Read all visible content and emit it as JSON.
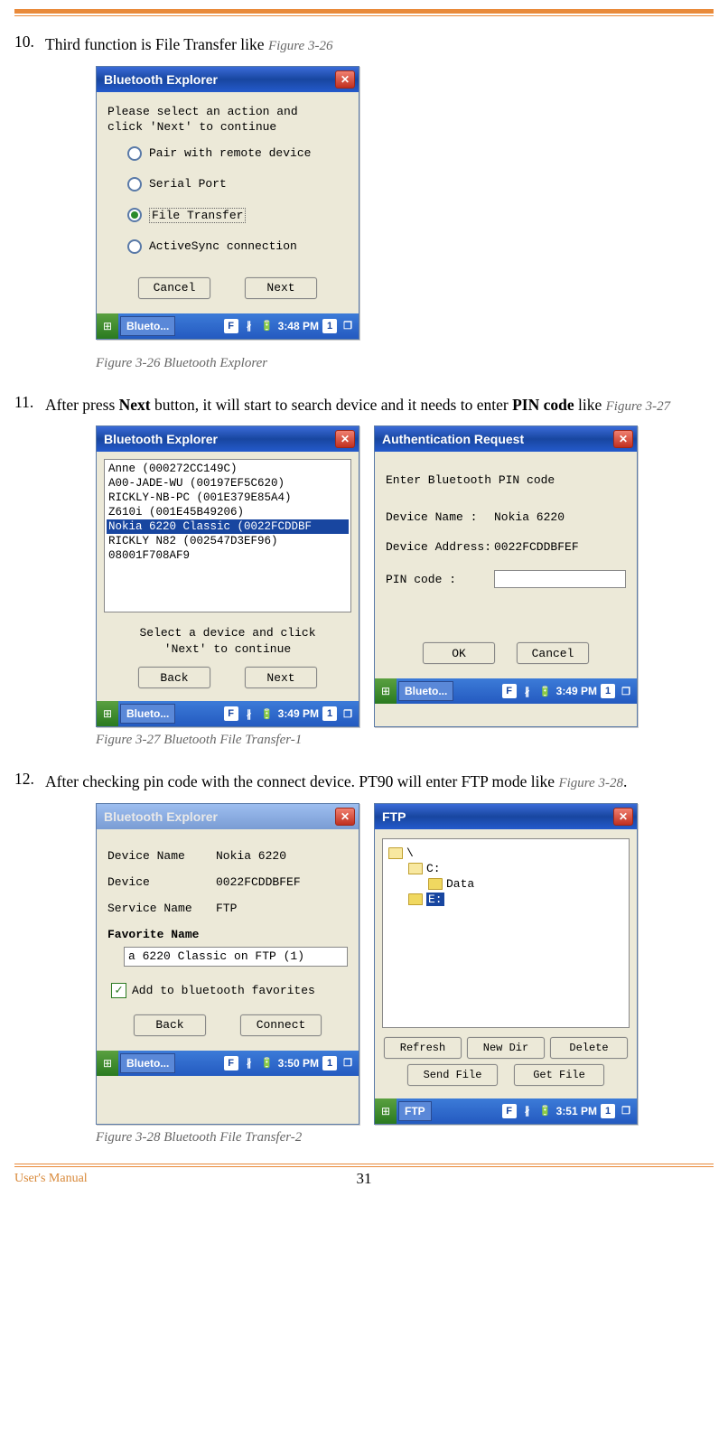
{
  "list": {
    "item10_num": "10.",
    "item10_text_a": "Third function is File Transfer like ",
    "item10_ref": "Figure 3-26",
    "item11_num": "11.",
    "item11_text_a": "After press ",
    "item11_bold1": "Next",
    "item11_text_b": " button, it will start to search device and it needs to enter ",
    "item11_bold2": "PIN code",
    "item11_text_c": " like ",
    "item11_ref": "Figure 3-27",
    "item12_num": "12.",
    "item12_text_a": "After checking pin code with the connect device. PT90 will enter FTP mode like ",
    "item12_ref": "Figure 3-28",
    "item12_dot": "."
  },
  "captions": {
    "c26": "Figure 3-26 Bluetooth Explorer",
    "c27": "Figure 3-27 Bluetooth File Transfer-1",
    "c28": "Figure 3-28 Bluetooth File Transfer-2"
  },
  "win26": {
    "title": "Bluetooth Explorer",
    "prompt1": "Please select an action and",
    "prompt2": "click 'Next'  to continue",
    "opt1": "Pair with remote device",
    "opt2": "Serial Port",
    "opt3": "File Transfer",
    "opt4": "ActiveSync connection",
    "cancel": "Cancel",
    "next": "Next",
    "task": "Blueto...",
    "time": "3:48 PM"
  },
  "win27a": {
    "title": "Bluetooth Explorer",
    "devices": [
      "Anne (000272CC149C)",
      "A00-JADE-WU (00197EF5C620)",
      "RICKLY-NB-PC (001E379E85A4)",
      "Z610i (001E45B49206)",
      "Nokia 6220 Classic (0022FCDDBF",
      "RICKLY N82 (002547D3EF96)",
      "08001F708AF9"
    ],
    "selected_index": 4,
    "inst1": "Select a device and click",
    "inst2": "'Next' to continue",
    "back": "Back",
    "next": "Next",
    "task": "Blueto...",
    "time": "3:49 PM"
  },
  "win27b": {
    "title": "Authentication Request",
    "prompt": "Enter Bluetooth PIN code",
    "devname_label": "Device Name   :",
    "devname_val": "Nokia 6220",
    "devaddr_label": "Device Address:",
    "devaddr_val": "0022FCDDBFEF",
    "pin_label": "PIN code      :",
    "ok": "OK",
    "cancel": "Cancel",
    "task": "Blueto...",
    "time": "3:49 PM"
  },
  "win28a": {
    "title": "Bluetooth Explorer",
    "devname_label": "Device Name",
    "devname_val": "Nokia 6220",
    "dev_label": "Device",
    "dev_val": "0022FCDDBFEF",
    "svc_label": "Service Name",
    "svc_val": "FTP",
    "fav_label": "Favorite Name",
    "fav_val": "a 6220 Classic on FTP (1)",
    "add_fav": "Add to bluetooth favorites",
    "back": "Back",
    "connect": "Connect",
    "task": "Blueto...",
    "time": "3:50 PM"
  },
  "win28b": {
    "title": "FTP",
    "tree": {
      "root": "\\",
      "c": "C:",
      "data": "Data",
      "e": "E:"
    },
    "refresh": "Refresh",
    "newdir": "New Dir",
    "delete": "Delete",
    "send": "Send File",
    "get": "Get File",
    "task": "FTP",
    "time": "3:51 PM"
  },
  "footer": {
    "left": "User's Manual",
    "page": "31"
  },
  "icons": {
    "close": "✕",
    "start": "⊞",
    "bt": "∦",
    "one": "1"
  }
}
